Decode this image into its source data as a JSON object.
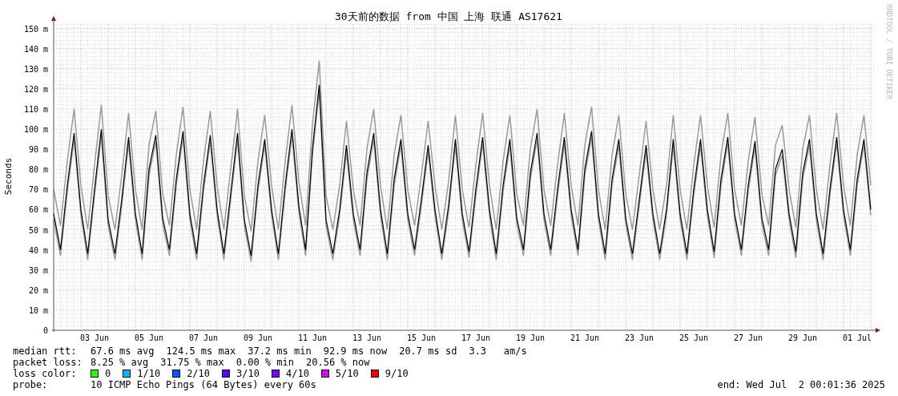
{
  "chart": {
    "watermark_note": "RRDTOOL / TOBI OETIKER",
    "chart_data": {
      "type": "line",
      "title": "30天前的数据 from 中国 上海 联通 AS17621",
      "ylabel": "Seconds",
      "grid": true,
      "ylim": [
        0,
        153
      ],
      "categories": [
        null,
        null,
        null,
        null,
        null,
        null,
        "03 Jun",
        null,
        null,
        null,
        null,
        null,
        null,
        null,
        "05 Jun",
        null,
        null,
        null,
        null,
        null,
        null,
        null,
        "07 Jun",
        null,
        null,
        null,
        null,
        null,
        null,
        null,
        "09 Jun",
        null,
        null,
        null,
        null,
        null,
        null,
        null,
        "11 Jun",
        null,
        null,
        null,
        null,
        null,
        null,
        null,
        "13 Jun",
        null,
        null,
        null,
        null,
        null,
        null,
        null,
        "15 Jun",
        null,
        null,
        null,
        null,
        null,
        null,
        null,
        "17 Jun",
        null,
        null,
        null,
        null,
        null,
        null,
        null,
        "19 Jun",
        null,
        null,
        null,
        null,
        null,
        null,
        null,
        "21 Jun",
        null,
        null,
        null,
        null,
        null,
        null,
        null,
        "23 Jun",
        null,
        null,
        null,
        null,
        null,
        null,
        null,
        "25 Jun",
        null,
        null,
        null,
        null,
        null,
        null,
        null,
        "27 Jun",
        null,
        null,
        null,
        null,
        null,
        null,
        null,
        "29 Jun",
        null,
        null,
        null,
        null,
        null,
        null,
        null,
        "01 Jul",
        null,
        null
      ],
      "yticks": [
        {
          "value": 0,
          "label": "0"
        },
        {
          "value": 10,
          "label": "10 m"
        },
        {
          "value": 20,
          "label": "20 m"
        },
        {
          "value": 30,
          "label": "30 m"
        },
        {
          "value": 40,
          "label": "40 m"
        },
        {
          "value": 50,
          "label": "50 m"
        },
        {
          "value": 60,
          "label": "60 m"
        },
        {
          "value": 70,
          "label": "70 m"
        },
        {
          "value": 80,
          "label": "80 m"
        },
        {
          "value": 90,
          "label": "90 m"
        },
        {
          "value": 100,
          "label": "100 m"
        },
        {
          "value": 110,
          "label": "110 m"
        },
        {
          "value": 120,
          "label": "120 m"
        },
        {
          "value": 130,
          "label": "130 m"
        },
        {
          "value": 140,
          "label": "140 m"
        },
        {
          "value": 150,
          "label": "150 m"
        }
      ],
      "series": [
        {
          "color": "#9a9a9a",
          "values": [
            70,
            52,
            84,
            110,
            72,
            50,
            82,
            112,
            67,
            50,
            77,
            108,
            70,
            50,
            92,
            109,
            68,
            52,
            87,
            111,
            70,
            50,
            84,
            109,
            72,
            50,
            80,
            110,
            67,
            49,
            84,
            107,
            72,
            50,
            84,
            112,
            74,
            52,
            102,
            134,
            67,
            50,
            72,
            104,
            70,
            52,
            90,
            110,
            72,
            50,
            87,
            107,
            70,
            52,
            77,
            104,
            72,
            50,
            74,
            107,
            70,
            51,
            82,
            108,
            72,
            50,
            84,
            107,
            68,
            52,
            90,
            110,
            70,
            52,
            82,
            108,
            72,
            52,
            92,
            111,
            70,
            50,
            87,
            107,
            68,
            50,
            77,
            104,
            70,
            50,
            72,
            107,
            70,
            50,
            82,
            107,
            72,
            51,
            87,
            108,
            70,
            52,
            84,
            106,
            68,
            52,
            92,
            102,
            70,
            51,
            90,
            107,
            70,
            50,
            82,
            108,
            72,
            52,
            87,
            107,
            72
          ]
        },
        {
          "color": "#9a9a9a",
          "values": [
            55,
            37,
            69,
            95,
            57,
            35,
            67,
            97,
            52,
            35,
            62,
            93,
            55,
            35,
            77,
            94,
            53,
            37,
            72,
            96,
            55,
            35,
            69,
            94,
            57,
            35,
            65,
            95,
            52,
            34,
            69,
            92,
            57,
            35,
            69,
            97,
            59,
            37,
            87,
            119,
            52,
            35,
            57,
            89,
            55,
            37,
            75,
            95,
            57,
            35,
            72,
            92,
            55,
            37,
            62,
            89,
            57,
            35,
            59,
            92,
            55,
            36,
            67,
            93,
            57,
            35,
            69,
            92,
            53,
            37,
            75,
            95,
            55,
            37,
            67,
            93,
            57,
            37,
            77,
            96,
            55,
            35,
            72,
            92,
            53,
            35,
            62,
            89,
            55,
            35,
            57,
            92,
            55,
            35,
            67,
            92,
            57,
            36,
            72,
            93,
            55,
            37,
            69,
            91,
            53,
            37,
            77,
            87,
            55,
            36,
            75,
            92,
            55,
            35,
            67,
            93,
            57,
            37,
            72,
            92,
            57
          ]
        },
        {
          "color": "#000000",
          "values": [
            58,
            40,
            72,
            98,
            60,
            38,
            70,
            100,
            55,
            38,
            65,
            96,
            58,
            38,
            80,
            97,
            56,
            40,
            75,
            99,
            58,
            38,
            72,
            97,
            60,
            38,
            68,
            98,
            55,
            37,
            72,
            95,
            60,
            38,
            72,
            100,
            62,
            40,
            90,
            122,
            55,
            38,
            60,
            92,
            58,
            40,
            78,
            98,
            60,
            38,
            75,
            95,
            58,
            40,
            65,
            92,
            60,
            38,
            62,
            95,
            58,
            39,
            70,
            96,
            60,
            38,
            72,
            95,
            56,
            40,
            78,
            98,
            58,
            40,
            70,
            96,
            60,
            40,
            80,
            99,
            58,
            38,
            75,
            95,
            56,
            38,
            65,
            92,
            58,
            38,
            60,
            95,
            58,
            38,
            70,
            95,
            60,
            39,
            75,
            96,
            58,
            40,
            72,
            94,
            56,
            40,
            80,
            90,
            58,
            39,
            78,
            95,
            58,
            38,
            70,
            96,
            60,
            40,
            75,
            95,
            60
          ]
        }
      ]
    }
  },
  "legend": {
    "lines": [
      {
        "kind": "stats",
        "label": "median rtt:",
        "values": [
          "67.6 ms avg",
          "124.5 ms max",
          "37.2 ms min",
          "92.9 ms now",
          "20.7 ms sd",
          "3.3   am/s"
        ]
      },
      {
        "kind": "stats",
        "label": "packet loss:",
        "values": [
          "8.25 % avg",
          "31.75 % max",
          "0.00 % min",
          "20.56 % now"
        ]
      },
      {
        "kind": "colors",
        "label": "loss color:",
        "items": [
          {
            "label": "0",
            "color": "#26ff00"
          },
          {
            "label": "1/10",
            "color": "#00b8ff"
          },
          {
            "label": "2/10",
            "color": "#0059ff"
          },
          {
            "label": "3/10",
            "color": "#5e00ff"
          },
          {
            "label": "4/10",
            "color": "#7e00ff"
          },
          {
            "label": "5/10",
            "color": "#dd00ff"
          },
          {
            "label": "9/10",
            "color": "#ff0000"
          }
        ]
      },
      {
        "kind": "probe",
        "label": "probe:",
        "text": "10 ICMP Echo Pings (64 Bytes) every 60s",
        "end": "end: Wed Jul  2 00:01:36 2025"
      }
    ]
  }
}
